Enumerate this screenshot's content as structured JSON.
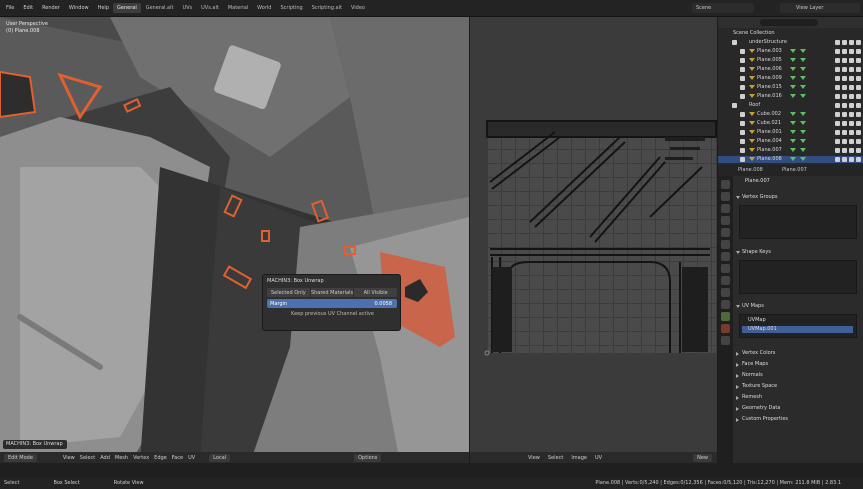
{
  "menu": [
    "File",
    "Edit",
    "Render",
    "Window",
    "Help"
  ],
  "workspaces": [
    {
      "label": "General",
      "active": true
    },
    {
      "label": "General.alt",
      "active": false
    },
    {
      "label": "UVs",
      "active": false
    },
    {
      "label": "UVs.alt",
      "active": false
    },
    {
      "label": "Material",
      "active": false
    },
    {
      "label": "World",
      "active": false
    },
    {
      "label": "Scripting",
      "active": false
    },
    {
      "label": "Scripting.alt",
      "active": false
    },
    {
      "label": "Video",
      "active": false
    }
  ],
  "scene_label": "Scene",
  "view_layer_label": "View Layer",
  "viewport": {
    "perspective_label": "User Perspective",
    "object_label": "(0) Plane.008",
    "toolbar": {
      "mode": "Edit Mode",
      "items": [
        "View",
        "Select",
        "Add",
        "Mesh",
        "Vertex",
        "Edge",
        "Face",
        "UV"
      ],
      "transform": "Local",
      "options": "Options"
    },
    "collapsed_panel": "MACHIN3: Box Unwrap"
  },
  "operator_panel": {
    "title": "MACHIN3: Box Unwrap",
    "options": [
      "Selected Only",
      "Shared Materials",
      "All Visible"
    ],
    "margin_label": "Margin",
    "margin_value": "0.0058",
    "hint": "Keep previous UV Channel active"
  },
  "uv_editor": {
    "toolbar": [
      "View",
      "Select",
      "Image",
      "UV"
    ],
    "new_label": "New"
  },
  "outliner": {
    "rows": [
      {
        "label": "Scene Collection",
        "indent": 0,
        "type": "collection",
        "selected": false
      },
      {
        "label": "underStructure",
        "indent": 1,
        "type": "collection",
        "selected": false
      },
      {
        "label": "Plane.003",
        "indent": 2,
        "type": "mesh",
        "selected": false
      },
      {
        "label": "Plane.005",
        "indent": 2,
        "type": "mesh",
        "selected": false
      },
      {
        "label": "Plane.006",
        "indent": 2,
        "type": "mesh",
        "selected": false
      },
      {
        "label": "Plane.009",
        "indent": 2,
        "type": "mesh",
        "selected": false
      },
      {
        "label": "Plane.015",
        "indent": 2,
        "type": "mesh",
        "selected": false
      },
      {
        "label": "Plane.016",
        "indent": 2,
        "type": "mesh",
        "selected": false
      },
      {
        "label": "Roof",
        "indent": 1,
        "type": "collection",
        "selected": false
      },
      {
        "label": "Cube.002",
        "indent": 2,
        "type": "mesh",
        "selected": false
      },
      {
        "label": "Cube.021",
        "indent": 2,
        "type": "mesh",
        "selected": false
      },
      {
        "label": "Plane.001",
        "indent": 2,
        "type": "mesh",
        "selected": false
      },
      {
        "label": "Plane.004",
        "indent": 2,
        "type": "mesh",
        "selected": false
      },
      {
        "label": "Plane.007",
        "indent": 2,
        "type": "mesh",
        "selected": false
      },
      {
        "label": "Plane.008",
        "indent": 2,
        "type": "mesh",
        "selected": true
      }
    ]
  },
  "properties": {
    "breadcrumb": [
      "Plane.008",
      "Plane.007"
    ],
    "object_name": "Plane.007",
    "sections": [
      {
        "label": "Vertex Groups",
        "open": true
      },
      {
        "label": "Shape Keys",
        "open": true
      },
      {
        "label": "UV Maps",
        "open": true
      },
      {
        "label": "Vertex Colors",
        "open": false
      },
      {
        "label": "Face Maps",
        "open": false
      },
      {
        "label": "Normals",
        "open": false
      },
      {
        "label": "Texture Space",
        "open": false
      },
      {
        "label": "Remesh",
        "open": false
      },
      {
        "label": "Geometry Data",
        "open": false
      },
      {
        "label": "Custom Properties",
        "open": false
      }
    ],
    "uv_maps": [
      {
        "label": "UVMap",
        "selected": false
      },
      {
        "label": "UVMap.001",
        "selected": true
      }
    ]
  },
  "statusbar": {
    "items": [
      "Select",
      "Box Select",
      "Rotate View"
    ],
    "stats": "Plane.008 | Verts:0/5,240 | Edges:0/12,356 | Faces:0/5,120 | Tris:12,270 | Mem: 211.8 MiB | 2.83.1"
  }
}
